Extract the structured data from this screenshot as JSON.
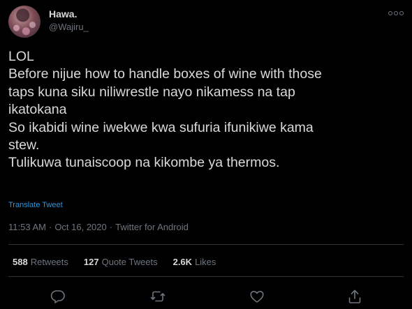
{
  "author": {
    "display_name": "Hawa.",
    "handle": "@Wajiru_"
  },
  "tweet": {
    "lines": [
      "LOL",
      "Before nijue how to handle boxes of wine with those",
      "taps kuna siku niliwrestle nayo nikamess na tap",
      "ikatokana",
      "So ikabidi wine iwekwe kwa sufuria ifunikiwe kama",
      "stew.",
      "Tulikuwa tunaiscoop na kikombe ya thermos."
    ],
    "translate_label": "Translate Tweet"
  },
  "meta": {
    "time": "11:53 AM",
    "separator": "·",
    "date": "Oct 16, 2020",
    "source": "Twitter for Android"
  },
  "stats": {
    "retweets_count": "588",
    "retweets_label": "Retweets",
    "quotes_count": "127",
    "quotes_label": "Quote Tweets",
    "likes_count": "2.6K",
    "likes_label": "Likes"
  },
  "actions": {
    "reply_icon": "reply-icon",
    "retweet_icon": "retweet-icon",
    "like_icon": "heart-icon",
    "share_icon": "share-icon"
  },
  "colors": {
    "background": "#000000",
    "text": "#d9d9d9",
    "secondary": "#6e767d",
    "link": "#1d9bf0",
    "divider": "#2f3336"
  }
}
